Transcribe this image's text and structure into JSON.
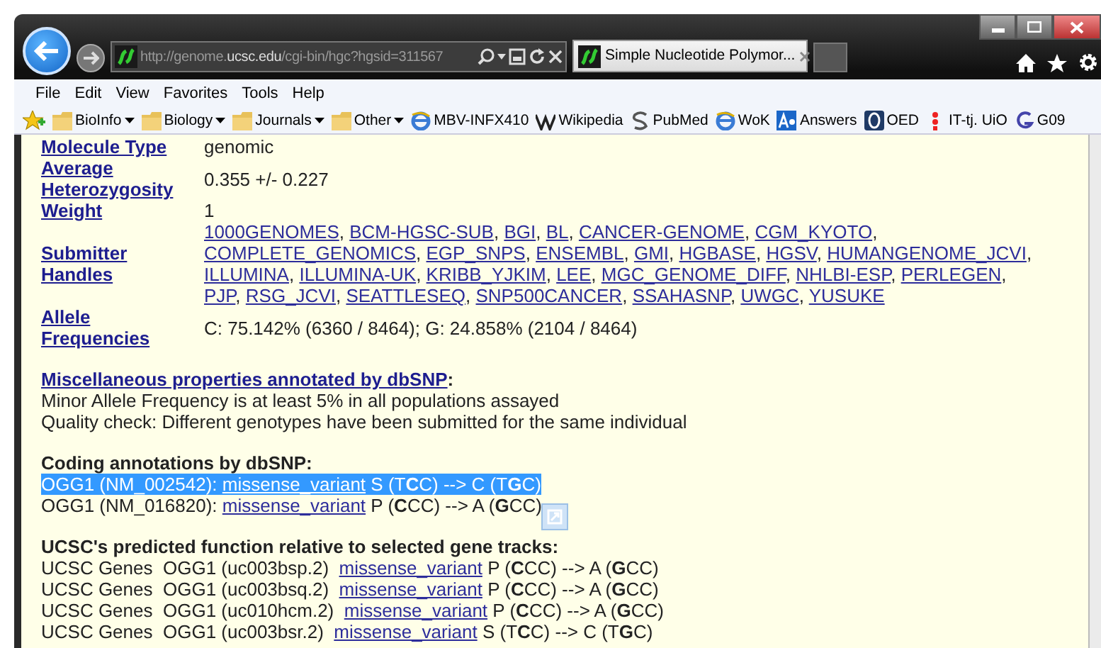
{
  "browser": {
    "address": {
      "host_pre": "http://genome.",
      "host_main": "ucsc.edu",
      "path": "/cgi-bin/hgc?hgsid=311567"
    },
    "tabs": [
      {
        "title": "Simple Nucleotide Polymor...",
        "selected": true
      }
    ]
  },
  "menu": [
    "File",
    "Edit",
    "View",
    "Favorites",
    "Tools",
    "Help"
  ],
  "favorites": [
    {
      "label": "BioInfo",
      "kind": "folder"
    },
    {
      "label": "Biology",
      "kind": "folder"
    },
    {
      "label": "Journals",
      "kind": "folder"
    },
    {
      "label": "Other",
      "kind": "folder"
    },
    {
      "label": "MBV-INFX410",
      "kind": "page"
    },
    {
      "label": "Wikipedia",
      "kind": "wiki"
    },
    {
      "label": "PubMed",
      "kind": "sync"
    },
    {
      "label": "WoK",
      "kind": "page"
    },
    {
      "label": "Answers",
      "kind": "answers"
    },
    {
      "label": "OED",
      "kind": "dictionary"
    },
    {
      "label": "IT-tj. UiO",
      "kind": "dots"
    },
    {
      "label": "G09",
      "kind": "letter"
    }
  ],
  "details": [
    {
      "label": "Molecule Type",
      "value": "genomic"
    },
    {
      "label": "Average Heterozygosity",
      "value": "0.355 +/- 0.227"
    },
    {
      "label": "Weight",
      "value": "1"
    },
    {
      "label": "Submitter Handles",
      "separator": ",",
      "links": [
        [
          "1000GENOMES",
          "BCM-HGSC-SUB",
          "BGI",
          "BL",
          "CANCER-GENOME",
          "CGM_KYOTO"
        ],
        [
          "COMPLETE_GENOMICS",
          "EGP_SNPS",
          "ENSEMBL",
          "GMI",
          "HGBASE",
          "HGSV",
          "HUMANGENOME_JCVI"
        ],
        [
          "ILLUMINA",
          "ILLUMINA-UK",
          "KRIBB_YJKIM",
          "LEE",
          "MGC_GENOME_DIFF",
          "NHLBI-ESP",
          "PERLEGEN"
        ],
        [
          "PJP",
          "RSG_JCVI",
          "SEATTLESEQ",
          "SNP500CANCER",
          "SSAHASNP",
          "UWGC",
          "YUSUKE"
        ]
      ]
    },
    {
      "label": "Allele Frequencies",
      "value": "C: 75.142% (6360 / 8464); G: 24.858% (2104 / 8464)"
    }
  ],
  "misc": {
    "heading_link": "Miscellaneous properties annotated by dbSNP",
    "heading_suffix": ":",
    "lines": [
      "Minor Allele Frequency is at least 5% in all populations assayed",
      "Quality check: Different genotypes have been submitted for the same individual"
    ]
  },
  "coding": {
    "heading": "Coding annotations by dbSNP:",
    "rows": [
      {
        "prefix": "OGG1 (NM_002542):",
        "link": "missense_variant",
        "change": "S (T**C**C) --> C (T**G**C)",
        "selected": true
      },
      {
        "prefix": "OGG1 (NM_016820):",
        "link": "missense_variant",
        "change": "P (**C**CC) --> A (**G**CC)",
        "selected": false
      }
    ]
  },
  "predicted": {
    "heading": "UCSC's predicted function relative to selected gene tracks:",
    "rows": [
      {
        "track": "UCSC Genes",
        "gene": "OGG1 (uc003bsp.2)",
        "link": "missense_variant",
        "change": "P (**C**CC) --> A (**G**CC)"
      },
      {
        "track": "UCSC Genes",
        "gene": "OGG1 (uc003bsq.2)",
        "link": "missense_variant",
        "change": "P (**C**CC) --> A (**G**CC)"
      },
      {
        "track": "UCSC Genes",
        "gene": "OGG1 (uc010hcm.2)",
        "link": "missense_variant",
        "change": "P (**C**CC) --> A (**G**CC)"
      },
      {
        "track": "UCSC Genes",
        "gene": "OGG1 (uc003bsr.2)",
        "link": "missense_variant",
        "change": "S (T**C**C) --> C (T**G**C)"
      }
    ]
  }
}
